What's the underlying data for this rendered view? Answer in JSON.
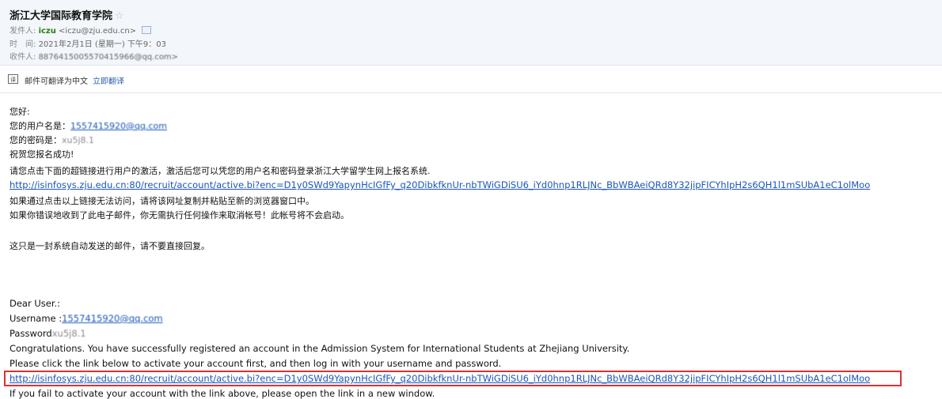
{
  "header": {
    "subject": "浙江大学国际教育学院",
    "star_icon": "star-outline-icon",
    "from_label": "发件人:",
    "from_name": "iczu",
    "from_email": "<iczu@zju.edu.cn>",
    "time_label": "时　间:",
    "time_value": "2021年2月1日 (星期一) 下午9：03",
    "to_label": "收件人:",
    "to_value": "8876415005570415966@qq.com>"
  },
  "translate": {
    "icon": "translate-icon",
    "text": "邮件可翻译为中文",
    "action": "立即翻译"
  },
  "body_cn": {
    "greeting": "您好:",
    "username_label": "您的用户名是：",
    "username_value": "1557415920@qq.com",
    "password_label": "您的密码是：",
    "password_value": "xu5j8.1",
    "congrats": "祝贺您报名成功!",
    "instruction": "请您点击下面的超链接进行用户的激活，激活后您可以凭您的用户名和密码登录浙江大学留学生网上报名系统.",
    "link": "http://isinfosys.zju.edu.cn:80/recruit/account/active.bi?enc=D1y0SWd9YapynHcIGfFy_q20DibkfknUr-nbTWiGDiSU6_iYd0hnp1RLJNc_BbWBAeiQRd8Y32jipFICYhIpH2s6QH1l1mSUbA1eC1olMoo",
    "fallback": "如果通过点击以上链接无法访问，请将该网址复制并粘贴至新的浏览器窗口中。",
    "mistake": "如果你错误地收到了此电子邮件，你无需执行任何操作来取消帐号！此帐号将不会启动。",
    "auto_notice": "这只是一封系统自动发送的邮件，请不要直接回复。"
  },
  "body_en": {
    "greeting": "Dear User.:",
    "username_label": "Username :",
    "username_value": "1557415920@qq.com",
    "password_label": "Password",
    "password_value": "xu5j8.1",
    "congrats": "Congratulations. You have successfully registered an account in the Admission System for International Students at Zhejiang University.",
    "instruction": "Please click the link below to activate your account first, and then log in with your username and password.",
    "link": "http://isinfosys.zju.edu.cn:80/recruit/account/active.bi?enc=D1y0SWd9YapynHcIGfFy_q20DibkfknUr-nbTWiGDiSU6_iYd0hnp1RLJNc_BbWBAeiQRd8Y32jipFICYhIpH2s6QH1l1mSUbA1eC1olMoo",
    "fallback": "If you fail to activate your account with the link above, please open the link in a new window."
  },
  "colors": {
    "header_bg": "#f3f6fb",
    "link": "#1a56b8",
    "sender_name": "#2e7d10",
    "highlight_box": "#e03030"
  }
}
